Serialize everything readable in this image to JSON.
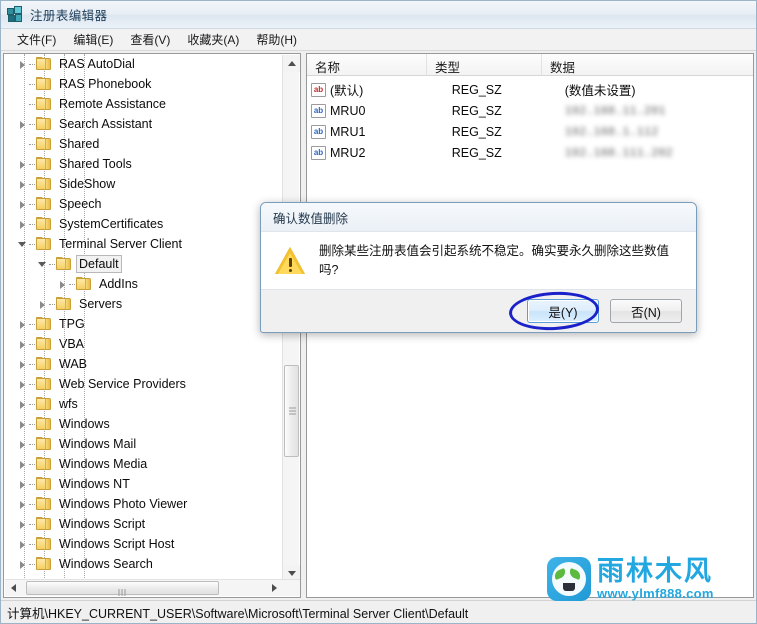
{
  "window": {
    "title": "注册表编辑器",
    "icon": "registry-editor-icon"
  },
  "menubar": {
    "items": [
      {
        "label": "文件(F)"
      },
      {
        "label": "编辑(E)"
      },
      {
        "label": "查看(V)"
      },
      {
        "label": "收藏夹(A)"
      },
      {
        "label": "帮助(H)"
      }
    ]
  },
  "tree": {
    "items": [
      {
        "label": "RAS AutoDial",
        "indent": 3,
        "expandable": true,
        "expanded": false,
        "selected": false
      },
      {
        "label": "RAS Phonebook",
        "indent": 3,
        "expandable": false,
        "expanded": false,
        "selected": false
      },
      {
        "label": "Remote Assistance",
        "indent": 3,
        "expandable": false,
        "expanded": false,
        "selected": false
      },
      {
        "label": "Search Assistant",
        "indent": 3,
        "expandable": true,
        "expanded": false,
        "selected": false
      },
      {
        "label": "Shared",
        "indent": 3,
        "expandable": false,
        "expanded": false,
        "selected": false
      },
      {
        "label": "Shared Tools",
        "indent": 3,
        "expandable": true,
        "expanded": false,
        "selected": false
      },
      {
        "label": "SideShow",
        "indent": 3,
        "expandable": true,
        "expanded": false,
        "selected": false
      },
      {
        "label": "Speech",
        "indent": 3,
        "expandable": true,
        "expanded": false,
        "selected": false
      },
      {
        "label": "SystemCertificates",
        "indent": 3,
        "expandable": true,
        "expanded": false,
        "selected": false
      },
      {
        "label": "Terminal Server Client",
        "indent": 3,
        "expandable": true,
        "expanded": true,
        "selected": false
      },
      {
        "label": "Default",
        "indent": 4,
        "expandable": true,
        "expanded": true,
        "selected": true
      },
      {
        "label": "AddIns",
        "indent": 5,
        "expandable": true,
        "expanded": false,
        "selected": false
      },
      {
        "label": "Servers",
        "indent": 4,
        "expandable": true,
        "expanded": false,
        "selected": false
      },
      {
        "label": "TPG",
        "indent": 3,
        "expandable": true,
        "expanded": false,
        "selected": false
      },
      {
        "label": "VBA",
        "indent": 3,
        "expandable": true,
        "expanded": false,
        "selected": false
      },
      {
        "label": "WAB",
        "indent": 3,
        "expandable": true,
        "expanded": false,
        "selected": false
      },
      {
        "label": "Web Service Providers",
        "indent": 3,
        "expandable": true,
        "expanded": false,
        "selected": false
      },
      {
        "label": "wfs",
        "indent": 3,
        "expandable": true,
        "expanded": false,
        "selected": false
      },
      {
        "label": "Windows",
        "indent": 3,
        "expandable": true,
        "expanded": false,
        "selected": false
      },
      {
        "label": "Windows Mail",
        "indent": 3,
        "expandable": true,
        "expanded": false,
        "selected": false
      },
      {
        "label": "Windows Media",
        "indent": 3,
        "expandable": true,
        "expanded": false,
        "selected": false
      },
      {
        "label": "Windows NT",
        "indent": 3,
        "expandable": true,
        "expanded": false,
        "selected": false
      },
      {
        "label": "Windows Photo Viewer",
        "indent": 3,
        "expandable": true,
        "expanded": false,
        "selected": false
      },
      {
        "label": "Windows Script",
        "indent": 3,
        "expandable": true,
        "expanded": false,
        "selected": false
      },
      {
        "label": "Windows Script Host",
        "indent": 3,
        "expandable": true,
        "expanded": false,
        "selected": false
      },
      {
        "label": "Windows Search",
        "indent": 3,
        "expandable": true,
        "expanded": false,
        "selected": false
      }
    ]
  },
  "list": {
    "columns": [
      {
        "label": "名称"
      },
      {
        "label": "类型"
      },
      {
        "label": "数据"
      }
    ],
    "rows": [
      {
        "name": "(默认)",
        "type": "REG_SZ",
        "data": "(数值未设置)",
        "icon": "string-value-icon-red",
        "data_blurred": false
      },
      {
        "name": "MRU0",
        "type": "REG_SZ",
        "data": "192.168.11.201",
        "icon": "string-value-icon-blue",
        "data_blurred": true
      },
      {
        "name": "MRU1",
        "type": "REG_SZ",
        "data": "192.168.1.112",
        "icon": "string-value-icon-blue",
        "data_blurred": true
      },
      {
        "name": "MRU2",
        "type": "REG_SZ",
        "data": "192.168.111.202",
        "icon": "string-value-icon-blue",
        "data_blurred": true
      }
    ]
  },
  "dialog": {
    "title": "确认数值删除",
    "message": "删除某些注册表值会引起系统不稳定。确实要永久删除这些数值吗?",
    "icon": "warning-icon",
    "buttons": [
      {
        "label": "是(Y)",
        "default": true,
        "annotated": true
      },
      {
        "label": "否(N)",
        "default": false,
        "annotated": false
      }
    ]
  },
  "statusbar": {
    "path": "计算机\\HKEY_CURRENT_USER\\Software\\Microsoft\\Terminal Server Client\\Default"
  },
  "watermark": {
    "brand": "雨林木风",
    "url": "www.ylmf888.com"
  },
  "colors": {
    "accent_blue": "#23a7e0",
    "annotation": "#1a21c8",
    "folder": "#f6cf63",
    "warning": "#f2c230"
  }
}
